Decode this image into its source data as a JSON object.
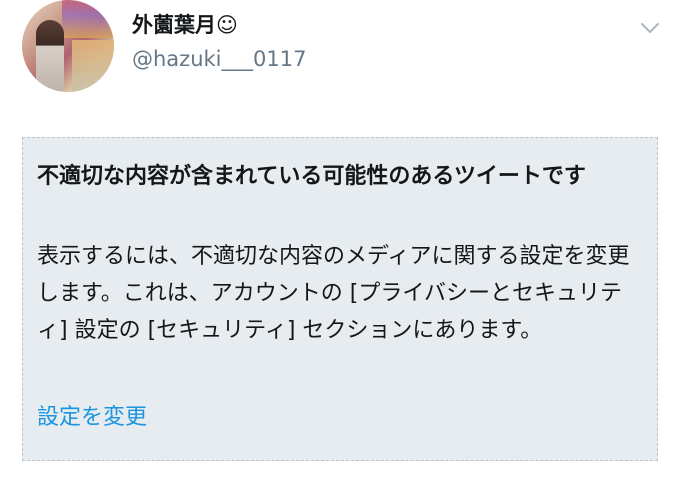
{
  "user": {
    "display_name": "外薗葉月☺",
    "handle": "@hazuki___0117"
  },
  "icons": {
    "caret": "chevron-down-icon"
  },
  "notice": {
    "title": "不適切な内容が含まれている可能性のあるツイートです",
    "body": "表示するには、不適切な内容のメディアに関する設定を変更します。これは、アカウントの [プライバシーとセキュリティ] 設定の [セキュリティ] セクションにあります。",
    "link_label": "設定を変更"
  },
  "colors": {
    "card_background": "#e6ecf0",
    "link": "#1b95e0",
    "secondary_text": "#657786"
  }
}
